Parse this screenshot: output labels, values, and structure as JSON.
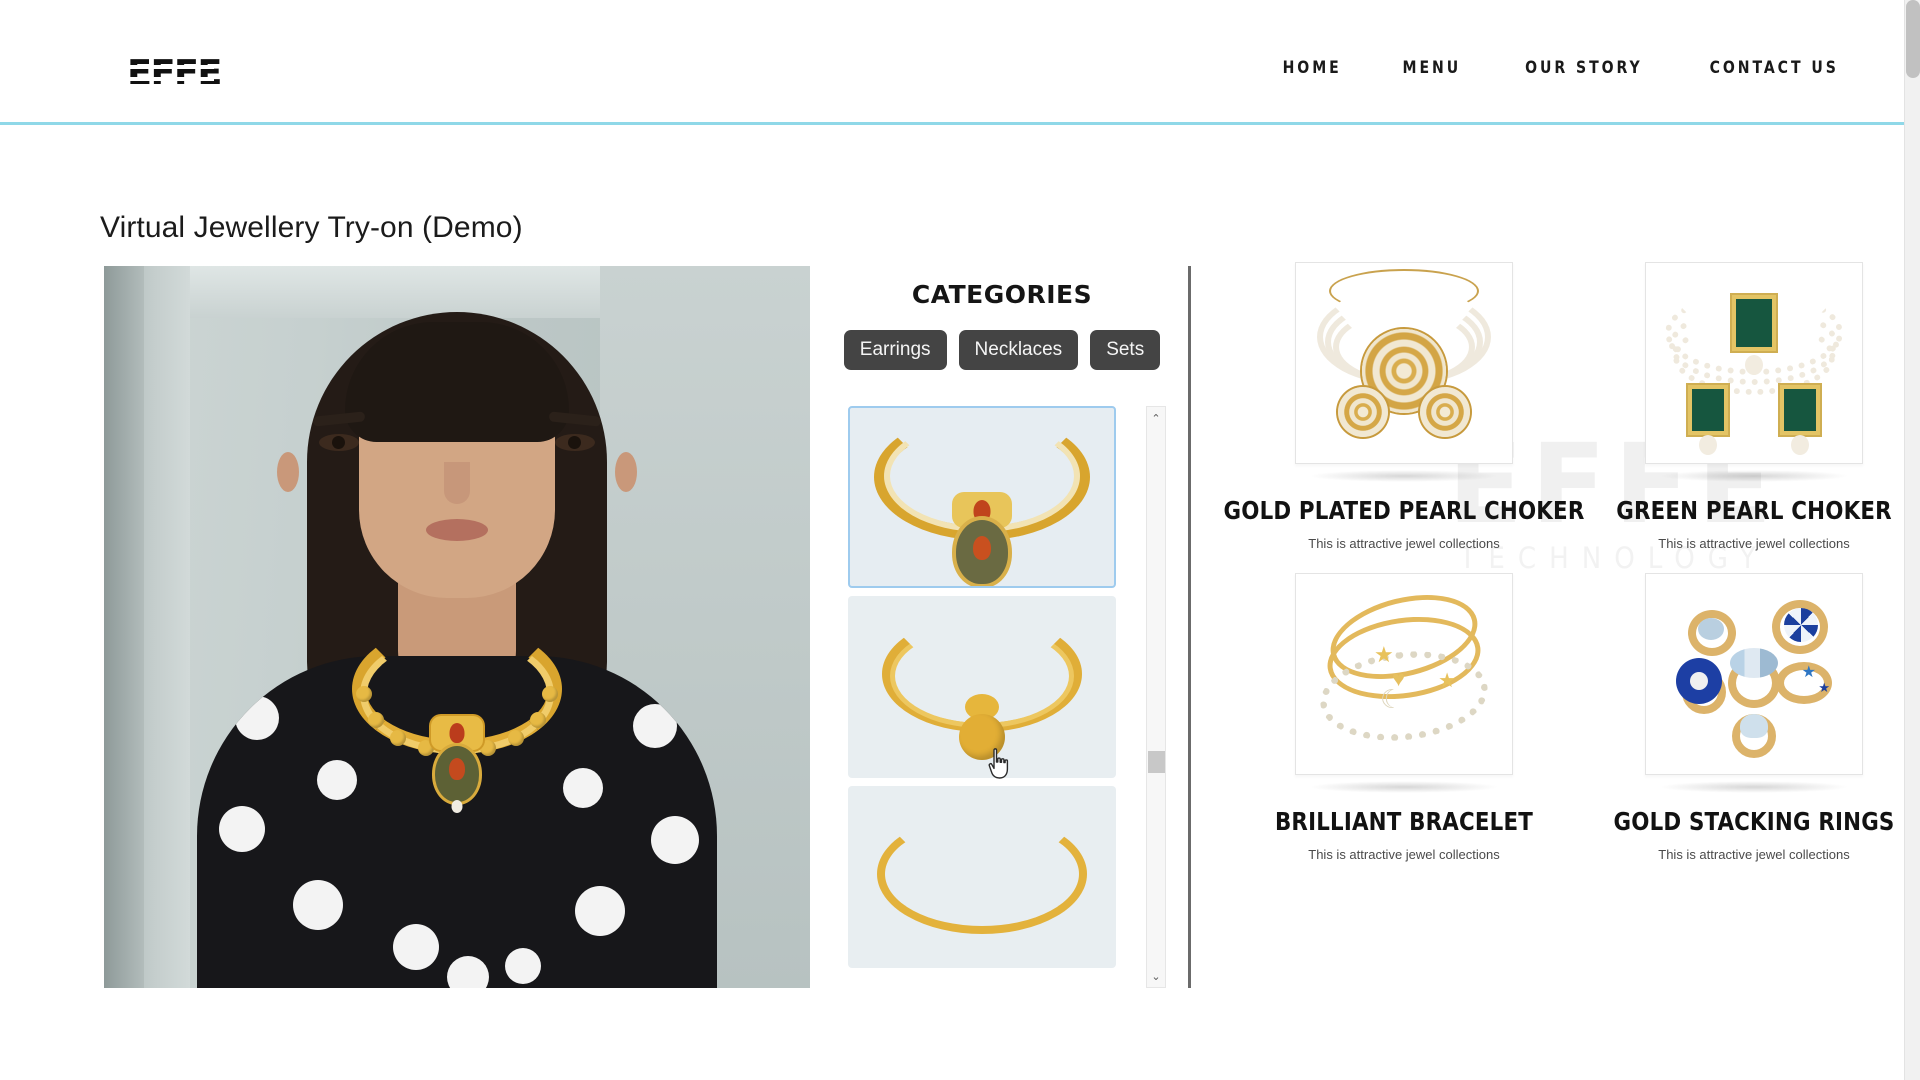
{
  "header": {
    "logo_text": "EFFE",
    "nav": [
      {
        "label": "HOME"
      },
      {
        "label": "MENU"
      },
      {
        "label": "OUR STORY"
      },
      {
        "label": "CONTACT US"
      }
    ]
  },
  "page": {
    "title": "Virtual Jewellery Try-on (Demo)"
  },
  "categories": {
    "heading": "CATEGORIES",
    "buttons": [
      {
        "label": "Earrings"
      },
      {
        "label": "Necklaces"
      },
      {
        "label": "Sets"
      }
    ],
    "thumbnails": [
      {
        "name": "traditional-gold-necklace-with-red-stone",
        "selected": true
      },
      {
        "name": "gold-chain-necklace-with-round-pendant",
        "selected": false
      },
      {
        "name": "thin-gold-necklace",
        "selected": false
      }
    ],
    "scrollbar": {
      "up_arrow": "⌃",
      "down_arrow": "⌄"
    }
  },
  "watermark": {
    "main": "EFFE",
    "sub": "TECHNOLOGY"
  },
  "products": [
    {
      "title": "GOLD PLATED PEARL CHOKER",
      "description": "This is attractive jewel collections",
      "image_name": "gold-plated-pearl-choker-set"
    },
    {
      "title": "GREEN PEARL CHOKER",
      "description": "This is attractive jewel collections",
      "image_name": "green-pearl-choker-set"
    },
    {
      "title": "BRILLIANT BRACELET",
      "description": "This is attractive jewel collections",
      "image_name": "brilliant-gold-bracelet-stack"
    },
    {
      "title": "GOLD STACKING RINGS",
      "description": "This is attractive jewel collections",
      "image_name": "gold-stacking-rings-set"
    }
  ],
  "colors": {
    "accent_rule": "#8fd8e8",
    "button_bg": "#444444",
    "selected_thumb_border": "#9ecbee",
    "gold": "#d9a52e",
    "emerald": "#16563f"
  }
}
